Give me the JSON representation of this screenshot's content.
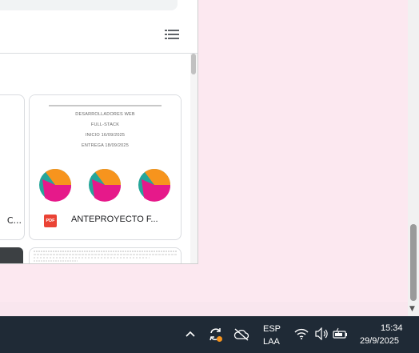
{
  "document_card": {
    "thumbnail_lines": [
      "DESARROLLADORES WEB",
      "FULL-STACK",
      "INICIO 16/09/2025",
      "ENTREGA 18/09/2025"
    ],
    "file_type_label": "PDF",
    "title": "ANTEPROYECTO F..."
  },
  "left_card": {
    "title_fragment": "C..."
  },
  "taskbar": {
    "language": "ESP",
    "keyboard_layout": "LAA",
    "time": "15:34",
    "date": "29/9/2025"
  },
  "colors": {
    "avatar_orange": "#f7941d",
    "avatar_magenta": "#e6198a",
    "avatar_teal": "#26a69a",
    "taskbar": "#1f2a36",
    "pdf_red": "#ea4335"
  },
  "icons": [
    "list-view-icon",
    "pdf-icon",
    "chevron-up-icon",
    "sync-icon",
    "cloud-off-icon",
    "wifi-icon",
    "volume-icon",
    "battery-icon"
  ]
}
